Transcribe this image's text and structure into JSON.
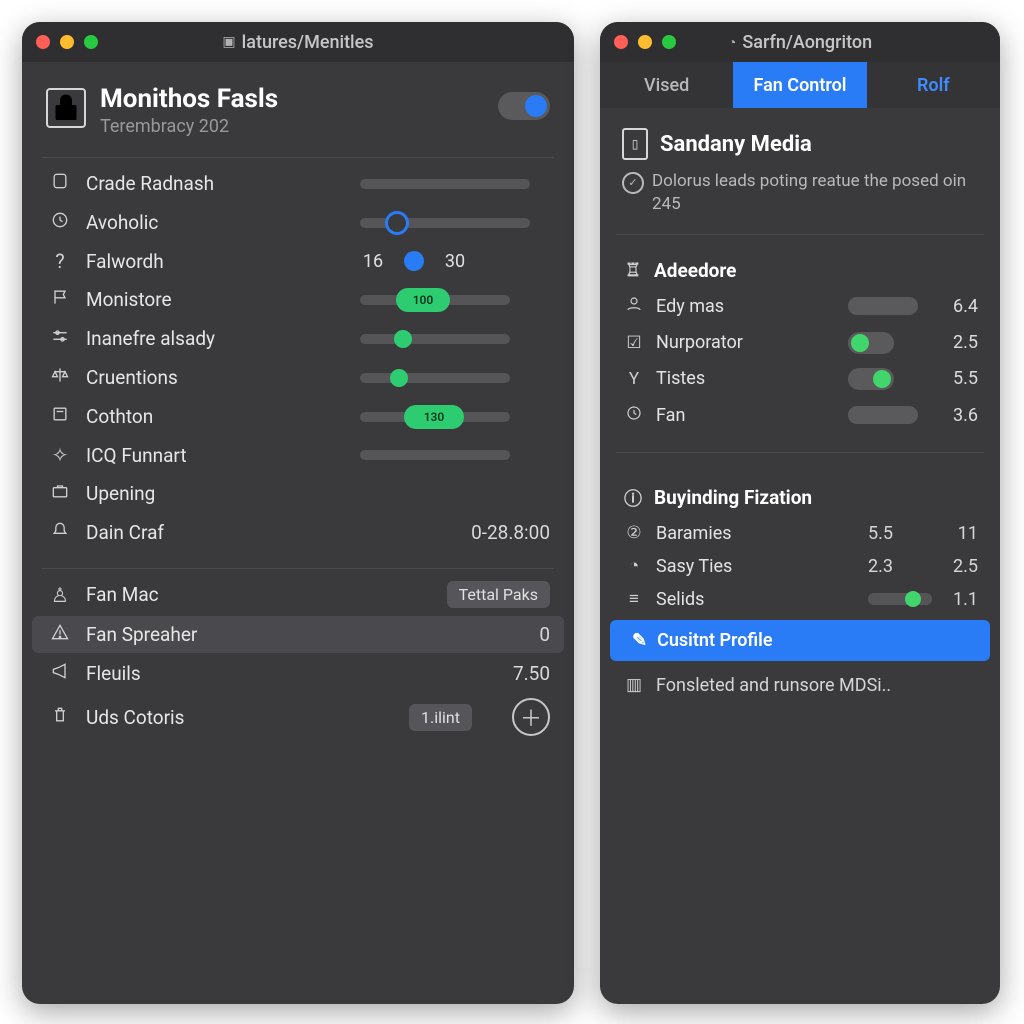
{
  "left": {
    "title": "latures/Menitles",
    "header_title": "Monithos Fasls",
    "header_subtitle": "Terembracy 202",
    "rows": {
      "r1": "Crade Radnash",
      "r2": "Avoholic",
      "r3": "Falwordh",
      "r3_v1": "16",
      "r3_v2": "30",
      "r4": "Monistore",
      "r4_pill": "100",
      "r5": "Inanefre alsady",
      "r6": "Cruentions",
      "r7": "Cothton",
      "r7_pill": "130",
      "r8": "ICQ Funnart",
      "r9": "Upening",
      "r10": "Dain Craf",
      "r10_val": "0-28.8:00"
    },
    "bottom": {
      "b1": "Fan Mac",
      "b1_chip": "Tettal Paks",
      "b2": "Fan Spreaher",
      "b2_val": "0",
      "b3": "Fleuils",
      "b3_val": "7.50",
      "b4": "Uds Cotoris",
      "b4_chip": "1.ilint"
    }
  },
  "right": {
    "title": "Sarfn/Aongriton",
    "tabs": {
      "t1": "Vised",
      "t2": "Fan Control",
      "t3": "Rolf"
    },
    "media_title": "Sandany Media",
    "media_desc": "Dolorus leads poting reatue the posed oin 245",
    "sec_a": "Adeedore",
    "a1": "Edy mas",
    "a1v": "6.4",
    "a2": "Nurporator",
    "a2v": "2.5",
    "a3": "Tistes",
    "a3v": "5.5",
    "a4": "Fan",
    "a4v": "3.6",
    "sec_b": "Buyinding Fization",
    "b1": "Baramies",
    "b1c1": "5.5",
    "b1c2": "11",
    "b2": "Sasy Ties",
    "b2c1": "2.3",
    "b2c2": "2.5",
    "b3": "Selids",
    "b3c2": "1.1",
    "profile": "Cusitnt Profile",
    "footer": "Fonsleted and runsore MDSi.."
  }
}
